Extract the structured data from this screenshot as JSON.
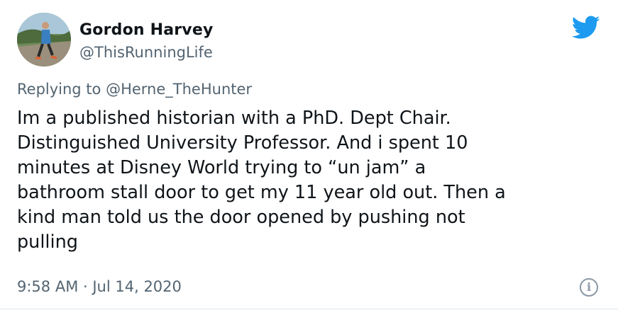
{
  "author": {
    "display_name": "Gordon Harvey",
    "handle": "@ThisRunningLife"
  },
  "reply": {
    "prefix": "Replying to ",
    "mention": "@Herne_TheHunter"
  },
  "tweet_text": "Im a published historian with a PhD. Dept Chair.\nDistinguished University Professor. And i spent 10\nminutes at Disney World trying to “un jam” a\nbathroom stall door to get my 11 year old out. Then a\nkind man told us the door opened by pushing not\npulling",
  "meta": {
    "time": "9:58 AM",
    "separator": " · ",
    "date": "Jul 14, 2020"
  },
  "icons": {
    "brand": "twitter-bird-icon",
    "info": "info-icon",
    "info_glyph": "i"
  },
  "colors": {
    "brand_blue": "#1d9bf0",
    "text_primary": "#0f1419",
    "text_secondary": "#536471"
  }
}
